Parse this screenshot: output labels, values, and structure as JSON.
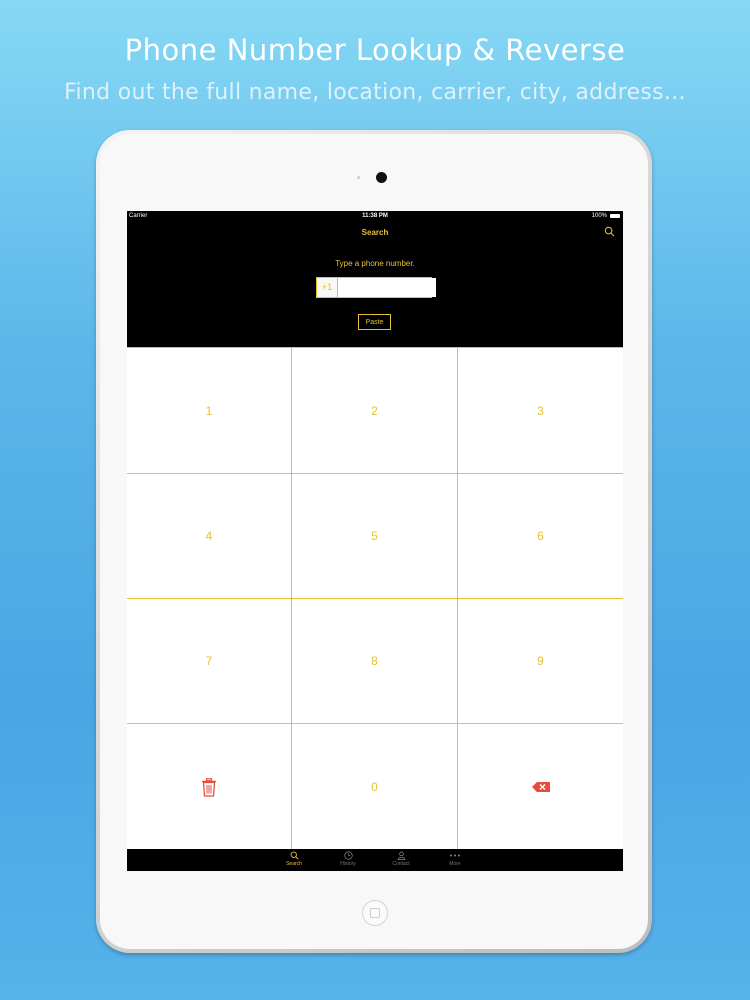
{
  "promo": {
    "title": "Phone Number Lookup & Reverse",
    "subtitle": "Find out the full name, location, carrier, city, address..."
  },
  "status_bar": {
    "carrier": "Carrier",
    "time": "11:38 PM",
    "battery": "100%"
  },
  "nav": {
    "title": "Search",
    "search_icon": "search-icon"
  },
  "search_form": {
    "prompt": "Type a phone number.",
    "country_code": "+1",
    "phone_value": "",
    "paste_label": "Paste"
  },
  "keypad": {
    "keys": [
      "1",
      "2",
      "3",
      "4",
      "5",
      "6",
      "7",
      "8",
      "9",
      "trash-icon",
      "0",
      "backspace-icon"
    ]
  },
  "tab_bar": {
    "tabs": [
      {
        "label": "Search",
        "icon": "search-icon",
        "active": true
      },
      {
        "label": "History",
        "icon": "clock-icon",
        "active": false
      },
      {
        "label": "Contact",
        "icon": "person-icon",
        "active": false
      },
      {
        "label": "More",
        "icon": "more-icon",
        "active": false
      }
    ]
  },
  "colors": {
    "accent": "#e5c230",
    "delete_red": "#e84c3d",
    "background_top": "#86d8f4",
    "background_bottom": "#4aa6e4"
  }
}
